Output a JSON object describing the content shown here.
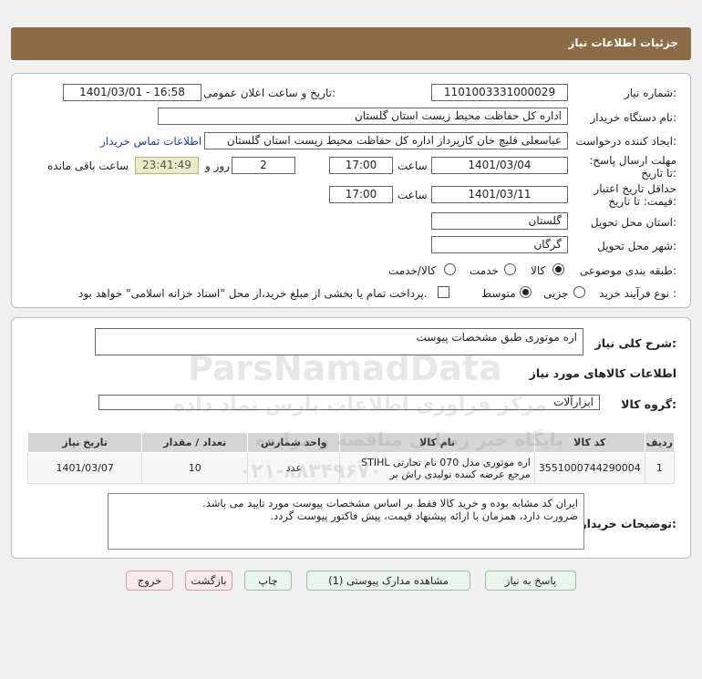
{
  "header": {
    "title": "جزئیات اطلاعات نیاز"
  },
  "form": {
    "need_number_label": "شماره نیاز:",
    "need_number": "1101003331000029",
    "announce_label": "تاریخ و ساعت اعلان عمومی:",
    "announce_value": "1401/03/01 - 16:58",
    "buyer_org_label": "نام دستگاه خریدار:",
    "buyer_org": "اداره کل حفاظت محیط زیست استان گلستان",
    "requester_label": "ایجاد کننده درخواست:",
    "requester": "عباسعلی  قلیچ خان  کارپرداز اداره کل حفاظت محیط زیست استان گلستان",
    "contact_link": "اطلاعات تماس خریدار",
    "deadline_label": "مهلت ارسال پاسخ: تا تاریخ:",
    "deadline_date": "1401/03/04",
    "time_label": "ساعت",
    "deadline_time": "17:00",
    "days_value": "2",
    "days_label": "روز و",
    "remaining_time": "23:41:49",
    "remaining_label": "ساعت باقی مانده",
    "validity_label": "حداقل تاریخ اعتبار قیمت: تا تاریخ:",
    "validity_date": "1401/03/11",
    "validity_time": "17:00",
    "province_label": "استان محل تحویل:",
    "province": "گلستان",
    "city_label": "شهر محل تحویل:",
    "city": "گرگان",
    "category_label": "طبقه بندی موضوعی:",
    "category_options": [
      "کالا",
      "خدمت",
      "کالا/خدمت"
    ],
    "process_label": "نوع فرآیند خرید :",
    "process_options": [
      "جزیی",
      "متوسط"
    ],
    "payment_note": "پرداخت تمام یا بخشی از مبلغ خرید،از محل \"اسناد خزانه اسلامی\" خواهد بود."
  },
  "summary": {
    "general_desc_label": "شرح کلی نیاز:",
    "general_desc": "اره موتوری طبق مشخصات پیوست",
    "goods_info_title": "اطلاعات کالاهای مورد نیاز",
    "goods_group_label": "گروه کالا:",
    "goods_group": "ابزارآلات"
  },
  "table": {
    "headers": [
      "ردیف",
      "کد کالا",
      "نام کالا",
      "واحد شمارش",
      "تعداد / مقدار",
      "تاریخ نیاز"
    ],
    "rows": [
      [
        "1",
        "3551000744290004",
        "اره موتوری مدل 070 نام تجارتی STIHL مرجع عرضه کننده تولیدی راش بر",
        "عدد",
        "10",
        "1401/03/07"
      ]
    ]
  },
  "buyer_notes": {
    "label": "توضیحات خریدار:",
    "line1": "ایران کد مشابه بوده و خرید کالا فقط بر اساس مشخصات پیوست مورد تایید می باشد.",
    "line2": "ضرورت دارد، همزمان با ارائه پیشنهاد قیمت، پیش فاکتور پیوست گردد."
  },
  "buttons": {
    "reply": "پاسخ به نیاز",
    "attachments": "مشاهده مدارک پیوستی (1)",
    "print": "چاپ",
    "back": "بازگشت",
    "exit": "خروج"
  },
  "watermark": {
    "line1": "ParsNamadData",
    "line2": "مرکز فراوری اطلاعات پارس نماد داده",
    "line3": "پایگاه خبر رسانی مناقصه و مزایده",
    "line4": "۰۲۱-۸۸۳۴۹۶۷۰"
  }
}
